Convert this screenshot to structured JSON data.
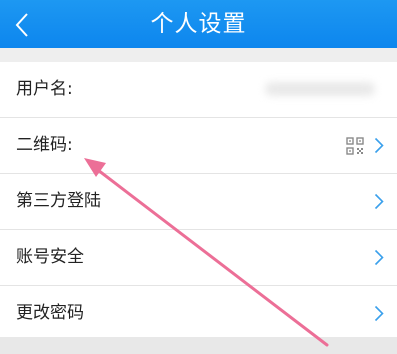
{
  "header": {
    "title": "个人设置",
    "back_icon": "chevron-left-icon"
  },
  "settings": {
    "rows": [
      {
        "label": "用户名:"
      },
      {
        "label": "二维码:"
      },
      {
        "label": "第三方登陆"
      },
      {
        "label": "账号安全"
      },
      {
        "label": "更改密码"
      }
    ]
  },
  "colors": {
    "header_bg": "#0d86ee",
    "chevron": "#3aa0ec",
    "annotation_arrow": "#ec6f97"
  }
}
